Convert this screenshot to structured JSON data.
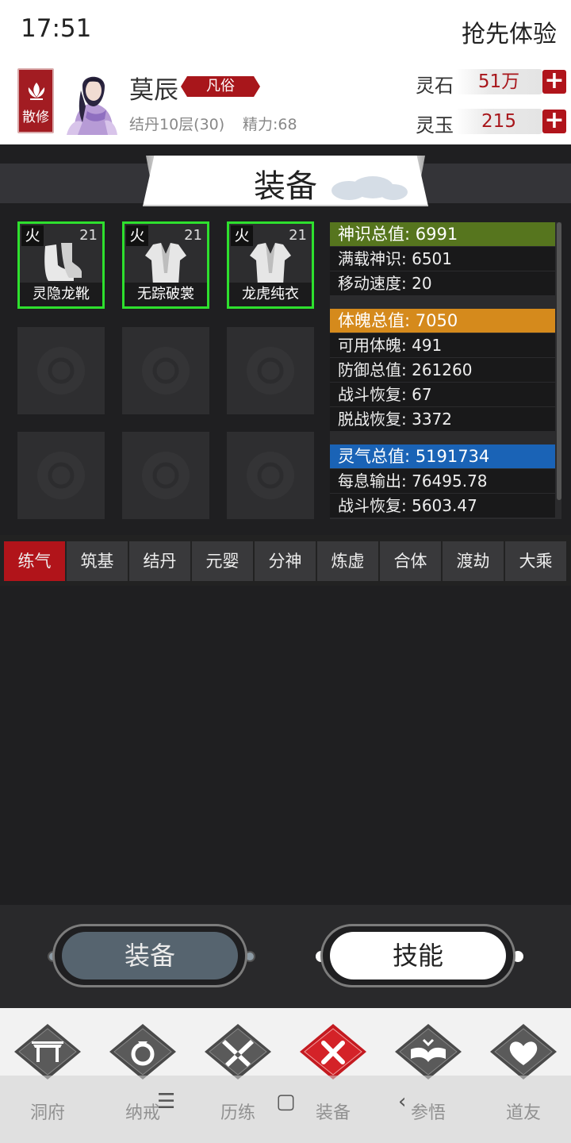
{
  "status_bar": {
    "time": "17:51",
    "right_text": "抢先体验"
  },
  "player": {
    "sect_badge": "散修",
    "name": "莫辰",
    "rank": "凡俗",
    "realm": "结丹10层(30)",
    "energy": "精力:68"
  },
  "currencies": [
    {
      "label": "灵石",
      "value": "51万"
    },
    {
      "label": "灵玉",
      "value": "215"
    }
  ],
  "page_title": "装备",
  "equipment_slots": [
    {
      "element": "火",
      "level": "21",
      "name": "灵隐龙靴",
      "icon": "boots-icon"
    },
    {
      "element": "火",
      "level": "21",
      "name": "无踪破裳",
      "icon": "robe-icon"
    },
    {
      "element": "火",
      "level": "21",
      "name": "龙虎纯衣",
      "icon": "robe-icon"
    }
  ],
  "empty_slot_count": 6,
  "stats": {
    "group1": {
      "header": "神识总值: 6991",
      "color": "#56751e",
      "rows": [
        "满载神识: 6501",
        "移动速度: 20"
      ]
    },
    "group2": {
      "header": "体魄总值: 7050",
      "color": "#d58a1c",
      "rows": [
        "可用体魄: 491",
        "防御总值: 261260",
        "战斗恢复: 67",
        "脱战恢复: 3372"
      ]
    },
    "group3": {
      "header": "灵气总值: 5191734",
      "color": "#1a63b6",
      "rows": [
        "每息输出: 76495.78",
        "战斗恢复: 5603.47"
      ]
    }
  },
  "realm_tabs": [
    "练气",
    "筑基",
    "结丹",
    "元婴",
    "分神",
    "炼虚",
    "合体",
    "渡劫",
    "大乘"
  ],
  "active_realm_tab": "练气",
  "actions": {
    "equip": "装备",
    "skills": "技能"
  },
  "bottom_nav": [
    {
      "label": "洞府",
      "icon": "cave-gate-icon"
    },
    {
      "label": "纳戒",
      "icon": "ring-icon"
    },
    {
      "label": "历练",
      "icon": "crossed-swords-icon"
    },
    {
      "label": "装备",
      "icon": "equipment-x-icon",
      "active": true
    },
    {
      "label": "参悟",
      "icon": "open-book-icon"
    },
    {
      "label": "道友",
      "icon": "heart-hands-icon"
    }
  ],
  "system_nav": {
    "menu": "☰",
    "home": "▢",
    "back": "‹"
  },
  "colors": {
    "accent_red": "#b1141a",
    "equip_border": "#2ee02e"
  }
}
